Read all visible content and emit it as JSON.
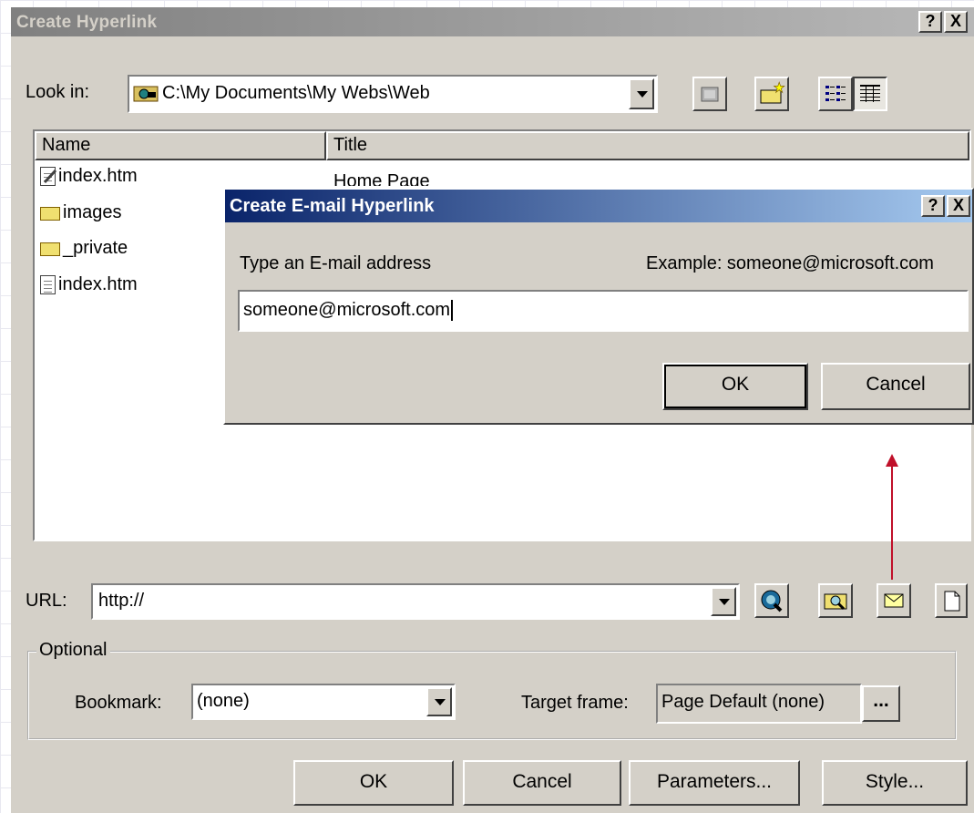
{
  "main_dialog": {
    "title": "Create Hyperlink",
    "help_btn": "?",
    "close_btn": "X",
    "look_in_label": "Look in:",
    "look_in_value": "C:\\My Documents\\My Webs\\Web",
    "columns": [
      "Name",
      "Title"
    ],
    "files": [
      {
        "name": "index.htm",
        "title": "Home Page",
        "icon": "edit-page-icon"
      },
      {
        "name": "images",
        "title": "",
        "icon": "folder-icon"
      },
      {
        "name": "_private",
        "title": "",
        "icon": "folder-icon"
      },
      {
        "name": "index.htm",
        "title": "",
        "icon": "page-icon"
      }
    ],
    "url_label": "URL:",
    "url_value": "http://",
    "optional_label": "Optional",
    "bookmark_label": "Bookmark:",
    "bookmark_value": "(none)",
    "target_frame_label": "Target frame:",
    "target_frame_value": "Page Default (none)",
    "target_browse": "...",
    "buttons": {
      "ok": "OK",
      "cancel": "Cancel",
      "parameters": "Parameters...",
      "style": "Style..."
    }
  },
  "email_dialog": {
    "title": "Create E-mail Hyperlink",
    "help_btn": "?",
    "close_btn": "X",
    "prompt": "Type an E-mail address",
    "example": "Example: someone@microsoft.com",
    "input_value": "someone@microsoft.com",
    "ok": "OK",
    "cancel": "Cancel"
  },
  "colors": {
    "active_title": "#0a246a",
    "inactive_title": "#808080",
    "arrow": "#c0102a",
    "face": "#d4d0c8"
  }
}
